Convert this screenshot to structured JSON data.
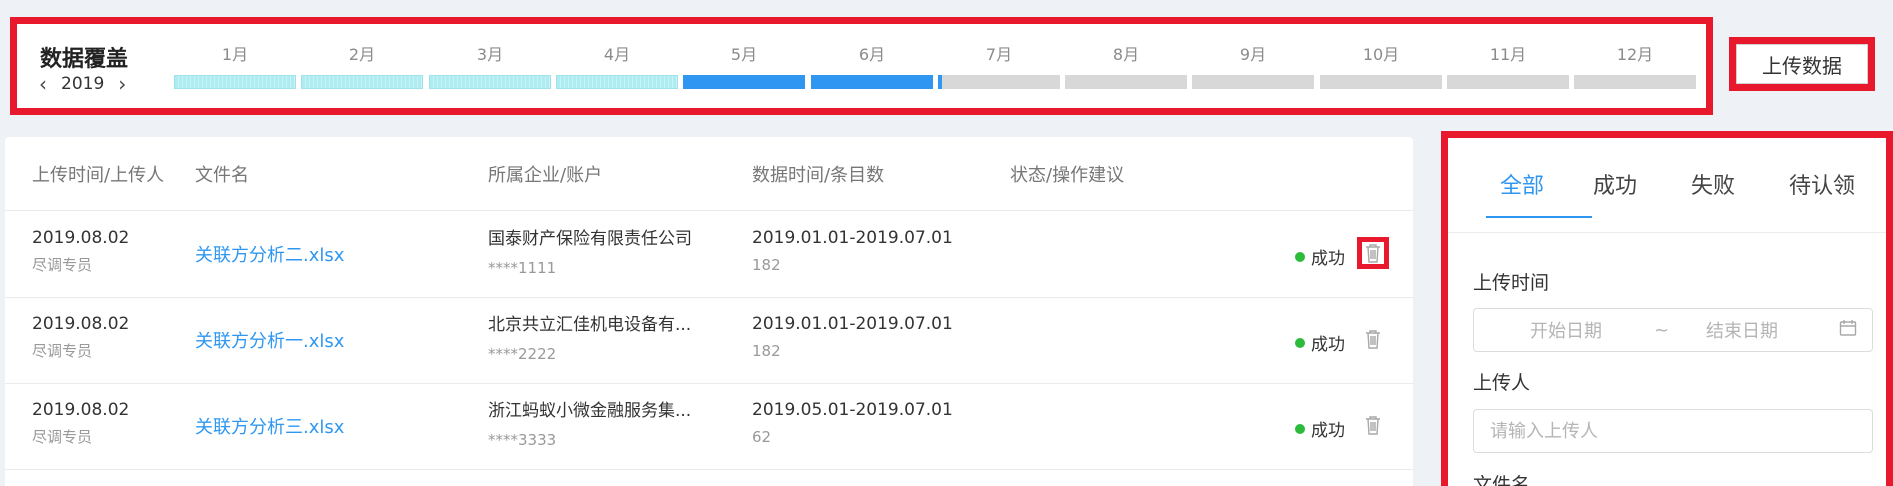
{
  "coverage": {
    "title": "数据覆盖",
    "year": "2019",
    "months": [
      {
        "label": "1月",
        "status": "partial",
        "fill": 1.0
      },
      {
        "label": "2月",
        "status": "partial",
        "fill": 1.0
      },
      {
        "label": "3月",
        "status": "partial",
        "fill": 1.0
      },
      {
        "label": "4月",
        "status": "partial",
        "fill": 1.0
      },
      {
        "label": "5月",
        "status": "full",
        "fill": 1.0
      },
      {
        "label": "6月",
        "status": "full",
        "fill": 1.0
      },
      {
        "label": "7月",
        "status": "sliver",
        "fill": 0.03
      },
      {
        "label": "8月",
        "status": "none",
        "fill": 0
      },
      {
        "label": "9月",
        "status": "none",
        "fill": 0
      },
      {
        "label": "10月",
        "status": "none",
        "fill": 0
      },
      {
        "label": "11月",
        "status": "none",
        "fill": 0
      },
      {
        "label": "12月",
        "status": "none",
        "fill": 0
      }
    ],
    "colors": {
      "partial": "#aeecf2",
      "full": "#2f97f1",
      "empty": "#d8d8d8"
    }
  },
  "upload_label": "上传数据",
  "table": {
    "headers": [
      "上传时间/上传人",
      "文件名",
      "所属企业/账户",
      "数据时间/条目数",
      "状态/操作建议"
    ],
    "rows": [
      {
        "date": "2019.08.02",
        "uploader": "尽调专员",
        "file": "关联方分析二.xlsx",
        "company": "国泰财产保险有限责任公司",
        "account": "****1111",
        "range": "2019.01.01-2019.07.01",
        "count": "182",
        "status": "成功"
      },
      {
        "date": "2019.08.02",
        "uploader": "尽调专员",
        "file": "关联方分析一.xlsx",
        "company": "北京共立汇佳机电设备有...",
        "account": "****2222",
        "range": "2019.01.01-2019.07.01",
        "count": "182",
        "status": "成功"
      },
      {
        "date": "2019.08.02",
        "uploader": "尽调专员",
        "file": "关联方分析三.xlsx",
        "company": "浙江蚂蚁小微金融服务集...",
        "account": "****3333",
        "range": "2019.05.01-2019.07.01",
        "count": "62",
        "status": "成功"
      }
    ]
  },
  "filter": {
    "tabs": [
      "全部",
      "成功",
      "失败",
      "待认领"
    ],
    "active_tab": "全部",
    "upload_time_label": "上传时间",
    "start_placeholder": "开始日期",
    "range_sep": "~",
    "end_placeholder": "结束日期",
    "uploader_label": "上传人",
    "uploader_placeholder": "请输入上传人",
    "filename_label": "文件名"
  }
}
